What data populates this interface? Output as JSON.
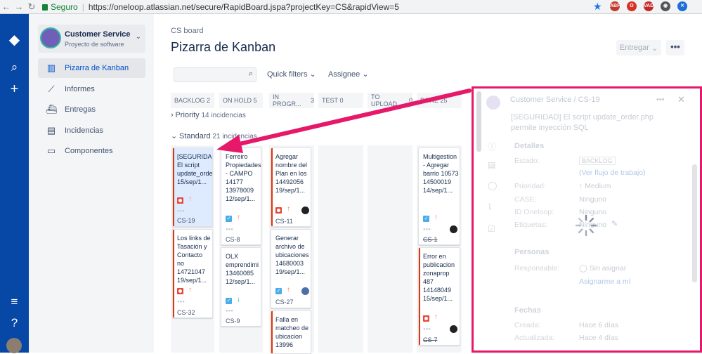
{
  "browser": {
    "secure_label": "Seguro",
    "url": "https://oneloop.atlassian.net/secure/RapidBoard.jspa?projectKey=CS&rapidView=5",
    "ext_abp": "ABP",
    "ext_vad": "VAD"
  },
  "project": {
    "name": "Customer Service",
    "type": "Proyecto de software"
  },
  "sidebar": {
    "items": [
      {
        "label": "Pizarra de Kanban",
        "icon": "board-icon",
        "active": true
      },
      {
        "label": "Informes",
        "icon": "chart-icon"
      },
      {
        "label": "Entregas",
        "icon": "ship-icon"
      },
      {
        "label": "Incidencias",
        "icon": "issues-icon"
      },
      {
        "label": "Componentes",
        "icon": "component-icon"
      }
    ]
  },
  "header": {
    "breadcrumb": "CS board",
    "title": "Pizarra de Kanban",
    "entregar": "Entregar",
    "more": "•••"
  },
  "filters": {
    "quick": "Quick filters",
    "assignee": "Assignee"
  },
  "columns": [
    {
      "name": "BACKLOG",
      "count": "2"
    },
    {
      "name": "ON HOLD",
      "count": "5"
    },
    {
      "name": "IN PROGR...",
      "count": "3"
    },
    {
      "name": "TEST",
      "count": "0"
    },
    {
      "name": "TO UPLOAD",
      "count": "0"
    },
    {
      "name": "DONE",
      "count": "25"
    }
  ],
  "swimlanes": [
    {
      "name": "Priority",
      "count": "14 incidencias",
      "chevron": "›"
    },
    {
      "name": "Standard",
      "count": "21 incidencias",
      "chevron": "⌄"
    }
  ],
  "cards": {
    "c1": {
      "title": "[SEGURIDAD] El script update_orde 15/sep/1...",
      "key": "CS-19"
    },
    "c2": {
      "title": "Los links de Tasación y Contacto no 14721047 19/sep/1...",
      "key": "CS-32"
    },
    "c3": {
      "title": "Ferreiro Propiedades - CAMPO 14177 13978009 12/sep/1...",
      "key": "CS-8"
    },
    "c4": {
      "title": "OLX emprendimi 13460085 12/sep/1...",
      "key": "CS-9"
    },
    "c5": {
      "title": "Agregar nombre del Plan en los 14492056 19/sep/1...",
      "key": "CS-11"
    },
    "c6": {
      "title": "Generar archivo de ubicaciones 14680003 19/sep/1...",
      "key": "CS-27"
    },
    "c7": {
      "title": "Falla en matcheo de ubicacion 13996",
      "key": ""
    },
    "c8": {
      "title": "Multigestion - Agregar barrio 10573 14500019 14/sep/1...",
      "key": "CS-1"
    },
    "c9": {
      "title": "Error en publicacion zonaprop 487 14148049 15/sep/1...",
      "key": "CS-7"
    }
  },
  "panel": {
    "project": "Customer Service",
    "sep": "/",
    "key": "CS-19",
    "title": "[SEGURIDAD] El script update_order.php permite inyección SQL",
    "details_title": "Detalles",
    "fields": [
      {
        "label": "Estado:",
        "value": "BACKLOG"
      },
      {
        "label": "",
        "value": "(Ver flujo de trabajo)"
      },
      {
        "label": "Prioridad:",
        "value": "Medium"
      },
      {
        "label": "CASE:",
        "value": "Ninguno"
      },
      {
        "label": "ID Oneloop:",
        "value": "Ninguno"
      },
      {
        "label": "Etiquetas:",
        "value": "Ninguno"
      }
    ],
    "people_title": "Personas",
    "responsable_label": "Responsable:",
    "responsable_value": "Sin asignar",
    "assign_me": "Asignarme a mí",
    "dates_title": "Fechas",
    "creada_label": "Creada:",
    "creada_value": "Hace 6 días",
    "actualizada_label": "Actualizada:",
    "actualizada_value": "Hace 4 días"
  },
  "colors": {
    "accent": "#0052cc",
    "globalnav": "#0747a6",
    "annotation": "#e6186a"
  }
}
